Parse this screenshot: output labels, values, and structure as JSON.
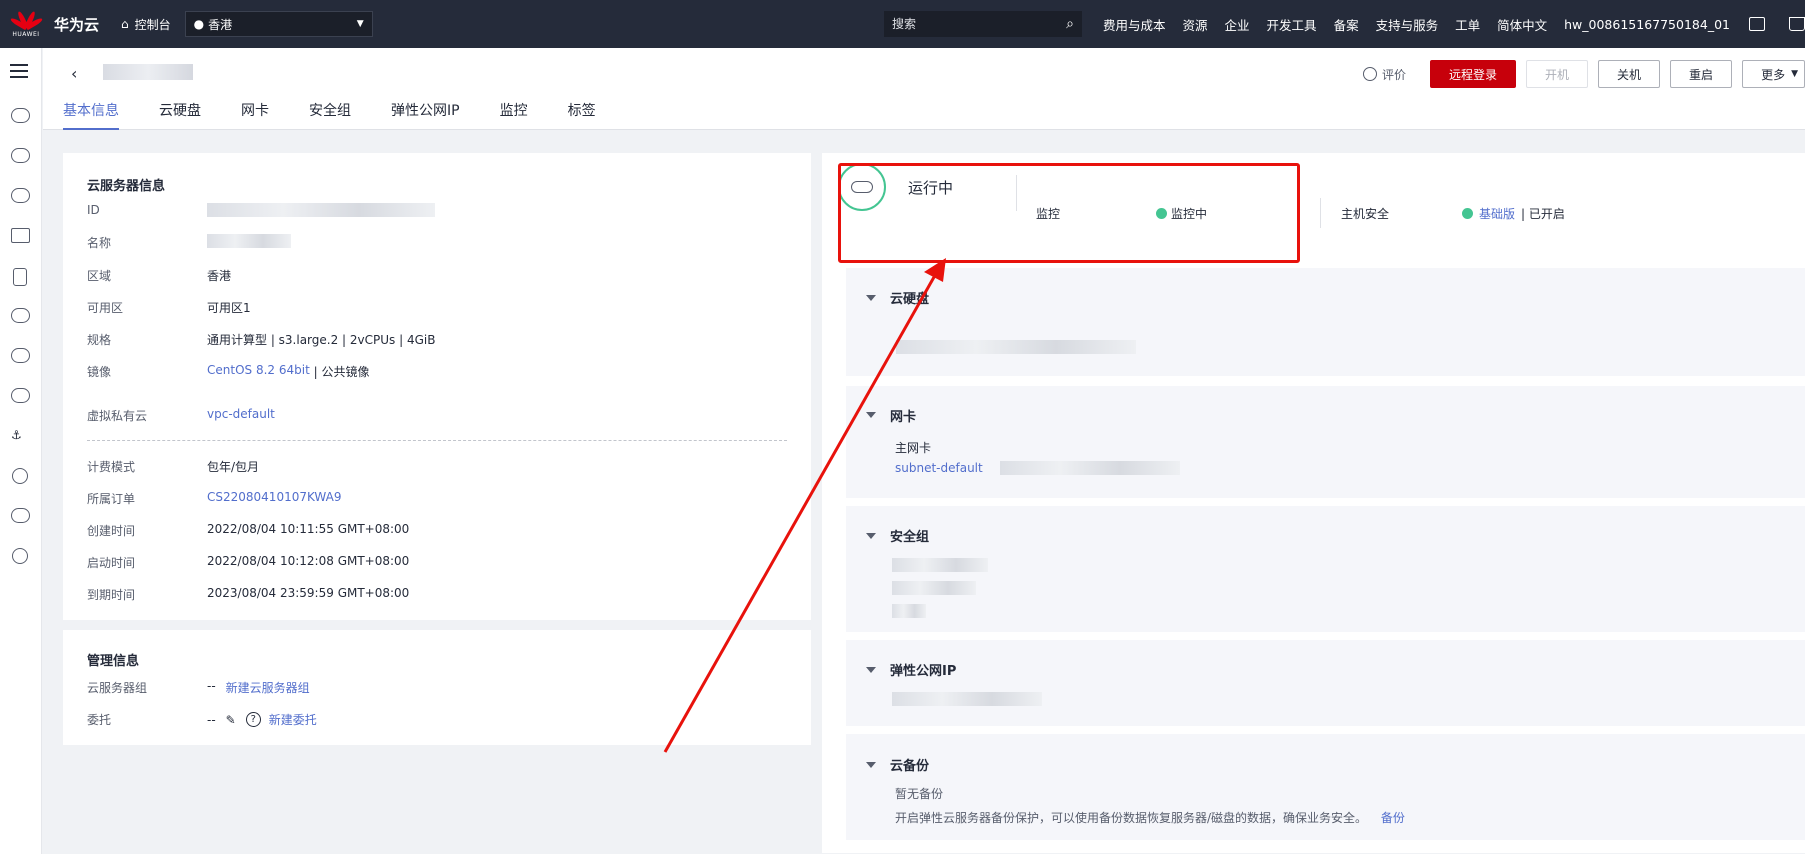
{
  "topbar": {
    "logo_text": "HUAWEI",
    "brand": "华为云",
    "console": "控制台",
    "region": "香港",
    "search_placeholder": "搜索",
    "nav": [
      "费用与成本",
      "资源",
      "企业",
      "开发工具",
      "备案",
      "支持与服务",
      "工单",
      "简体中文"
    ],
    "account": "hw_008615167750184_01"
  },
  "header": {
    "tabs": [
      "基本信息",
      "云硬盘",
      "网卡",
      "安全组",
      "弹性公网IP",
      "监控",
      "标签"
    ],
    "rate": "评价",
    "buttons": {
      "remote_login": "远程登录",
      "start": "开机",
      "stop": "关机",
      "restart": "重启",
      "more": "更多"
    }
  },
  "server_info": {
    "title": "云服务器信息",
    "id_label": "ID",
    "name_label": "名称",
    "region_label": "区域",
    "region": "香港",
    "az_label": "可用区",
    "az": "可用区1",
    "spec_label": "规格",
    "spec": "通用计算型 | s3.large.2 | 2vCPUs | 4GiB",
    "image_label": "镜像",
    "image_link": "CentOS 8.2 64bit",
    "image_suffix": " | 公共镜像",
    "vpc_label": "虚拟私有云",
    "vpc": "vpc-default",
    "billing_label": "计费模式",
    "billing": "包年/包月",
    "order_label": "所属订单",
    "order": "CS22080410107KWA9",
    "created_label": "创建时间",
    "created": "2022/08/04 10:11:55 GMT+08:00",
    "started_label": "启动时间",
    "started": "2022/08/04 10:12:08 GMT+08:00",
    "expire_label": "到期时间",
    "expire": "2023/08/04 23:59:59 GMT+08:00"
  },
  "mgmt_info": {
    "title": "管理信息",
    "group_label": "云服务器组",
    "group_value": "--",
    "group_link": "新建云服务器组",
    "delegate_label": "委托",
    "delegate_value": "--",
    "delegate_link": "新建委托"
  },
  "status": {
    "state": "运行中",
    "monitor_label": "监控",
    "monitor_value": "监控中",
    "host_security_label": "主机安全",
    "host_security_link": "基础版",
    "host_security_suffix": "| 已开启"
  },
  "sections": {
    "disk": {
      "title": "云硬盘"
    },
    "nic": {
      "title": "网卡",
      "primary": "主网卡",
      "subnet": "subnet-default"
    },
    "sg": {
      "title": "安全组"
    },
    "eip": {
      "title": "弹性公网IP"
    },
    "backup": {
      "title": "云备份",
      "empty": "暂无备份",
      "hint": "开启弹性云服务器备份保护，可以使用备份数据恢复服务器/磁盘的数据，确保业务安全。",
      "link": "备份"
    }
  },
  "colors": {
    "accent": "#526ecc",
    "brand_red": "#c7000b",
    "running_green": "#44c592",
    "annotation_red": "#e8120c"
  }
}
